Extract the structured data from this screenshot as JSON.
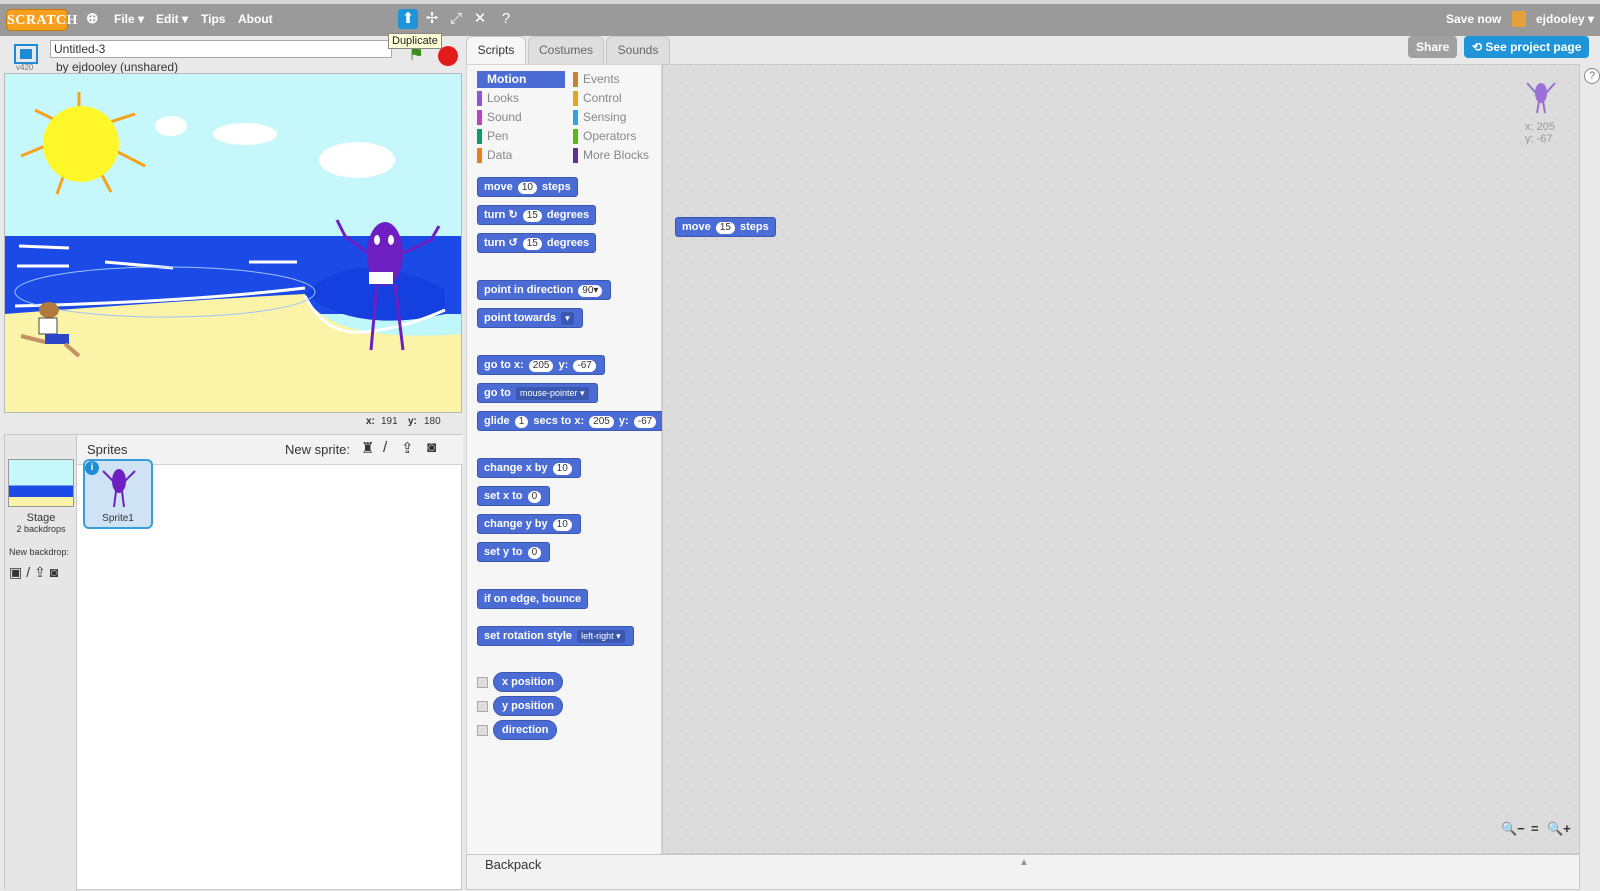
{
  "app": {
    "logo": "SCRATCH",
    "menu": [
      "File ▾",
      "Edit ▾",
      "Tips",
      "About"
    ],
    "save_now": "Save now",
    "username": "ejdooley ▾",
    "tooltip": "Duplicate"
  },
  "project": {
    "title": "Untitled-3",
    "byline": "by ejdooley (unshared)",
    "version": "v420"
  },
  "stage_coords": {
    "x_label": "x:",
    "x": "191",
    "y_label": "y:",
    "y": "180"
  },
  "sprite_pane": {
    "title": "Sprites",
    "new_sprite_label": "New sprite:",
    "stage_label": "Stage",
    "backdrops": "2 backdrops",
    "new_backdrop_label": "New backdrop:",
    "sprites": [
      {
        "name": "Sprite1"
      }
    ]
  },
  "tabs": [
    "Scripts",
    "Costumes",
    "Sounds"
  ],
  "buttons": {
    "share": "Share",
    "project_page": "See project page"
  },
  "categories": {
    "left": [
      "Motion",
      "Looks",
      "Sound",
      "Pen",
      "Data"
    ],
    "right": [
      "Events",
      "Control",
      "Sensing",
      "Operators",
      "More Blocks"
    ],
    "colors_left": [
      "#4a6cd4",
      "#8a55d7",
      "#bb42c3",
      "#0e9a6c",
      "#ee7d16"
    ],
    "colors_right": [
      "#c88330",
      "#e1a91a",
      "#2ca5e2",
      "#5cb712",
      "#632d99"
    ]
  },
  "blocks": {
    "move_steps": {
      "a": "move",
      "n": "10",
      "b": "steps"
    },
    "turn_right": {
      "a": "turn ↻",
      "n": "15",
      "b": "degrees"
    },
    "turn_left": {
      "a": "turn ↺",
      "n": "15",
      "b": "degrees"
    },
    "point_direction": {
      "a": "point in direction",
      "v": "90▾"
    },
    "point_towards": {
      "a": "point towards",
      "v": "▾"
    },
    "go_to_xy": {
      "a": "go to x:",
      "x": "205",
      "b": "y:",
      "y": "-67"
    },
    "go_to": {
      "a": "go to",
      "v": "mouse-pointer ▾"
    },
    "glide": {
      "a": "glide",
      "n": "1",
      "b": "secs to x:",
      "x": "205",
      "c": "y:",
      "y": "-67"
    },
    "change_x": {
      "a": "change x by",
      "n": "10"
    },
    "set_x": {
      "a": "set x to",
      "n": "0"
    },
    "change_y": {
      "a": "change y by",
      "n": "10"
    },
    "set_y": {
      "a": "set y to",
      "n": "0"
    },
    "bounce": {
      "a": "if on edge, bounce"
    },
    "rotation_style": {
      "a": "set rotation style",
      "v": "left-right ▾"
    },
    "x_position": {
      "a": "x position"
    },
    "y_position": {
      "a": "y position"
    },
    "direction": {
      "a": "direction"
    }
  },
  "script_block": {
    "a": "move",
    "n": "15",
    "b": "steps"
  },
  "sprite_info": {
    "x": "x: 205",
    "y": "y: -67"
  },
  "backpack": "Backpack",
  "zoom": {
    "out": "🔍−",
    "reset": "=",
    "in": "🔍+"
  }
}
